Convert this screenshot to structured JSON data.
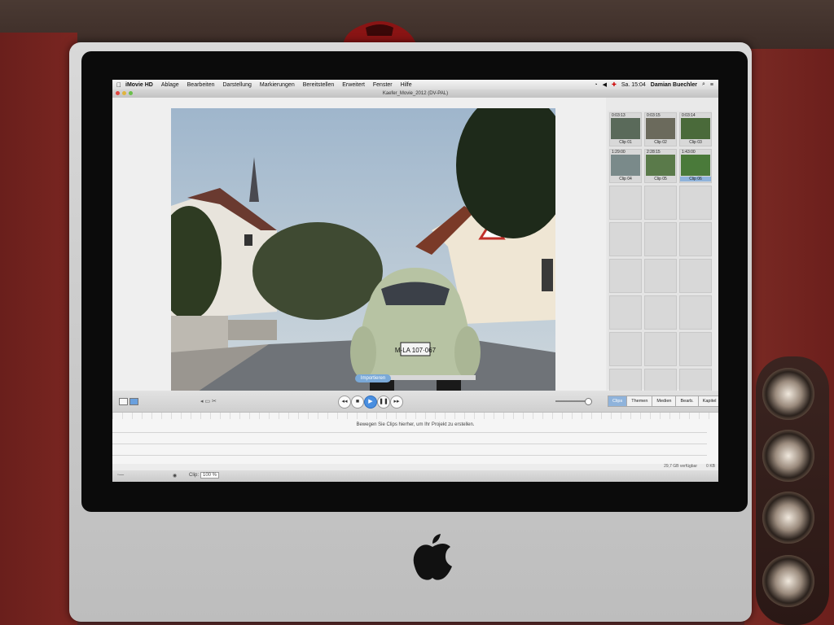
{
  "menubar": {
    "apple": "",
    "items": [
      "iMovie HD",
      "Ablage",
      "Bearbeiten",
      "Darstellung",
      "Markierungen",
      "Bereitstellen",
      "Erweitert",
      "Fenster",
      "Hilfe"
    ],
    "clock": "Sa. 15:04",
    "user": "Damian Buechler"
  },
  "window": {
    "title": "Kaefer_Movie_2012 (DV-PAL)"
  },
  "viewer": {
    "import_label": "Importieren",
    "plate": "M-LA 107·067"
  },
  "clips": [
    {
      "time": "0:03:13",
      "label": "Clip 01"
    },
    {
      "time": "0:03:15",
      "label": "Clip 02"
    },
    {
      "time": "0:03:14",
      "label": "Clip 03"
    },
    {
      "time": "1:29:00",
      "label": "Clip 04"
    },
    {
      "time": "2:28:15",
      "label": "Clip 05"
    },
    {
      "time": "1:43:00",
      "label": "Clip 06"
    }
  ],
  "tabs": [
    "Clips",
    "Themen",
    "Medien",
    "Bearb.",
    "Kapitel"
  ],
  "timeline": {
    "hint": "Bewegen Sie Clips hierher, um Ihr Projekt zu erstellen."
  },
  "status": {
    "free_space": "29,7 GB verfügbar",
    "trash": "0 KB"
  },
  "bottom": {
    "clip_label": "Clip:",
    "clip_value": "100 %"
  },
  "colors": {
    "accent": "#4a8fe0",
    "selection": "#8fb3db"
  }
}
